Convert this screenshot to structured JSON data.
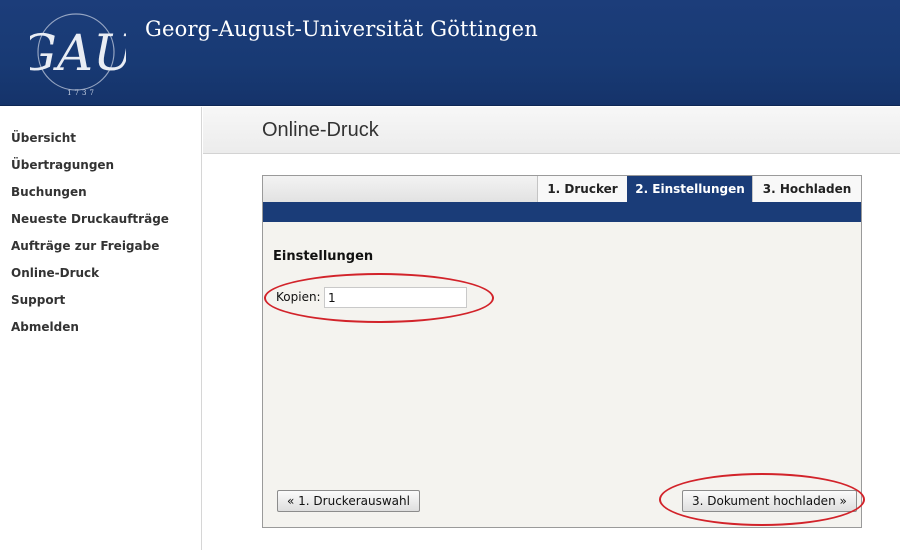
{
  "header": {
    "title": "Georg-August-Universität Göttingen",
    "logo": {
      "letters": "GAU",
      "year": "1737",
      "icon": "university-seal-icon"
    }
  },
  "sidebar": {
    "items": [
      {
        "label": "Übersicht"
      },
      {
        "label": "Übertragungen"
      },
      {
        "label": "Buchungen"
      },
      {
        "label": "Neueste Druckaufträge"
      },
      {
        "label": "Aufträge zur Freigabe"
      },
      {
        "label": "Online-Druck"
      },
      {
        "label": "Support"
      },
      {
        "label": "Abmelden"
      }
    ]
  },
  "main": {
    "page_title": "Online-Druck",
    "tabs": [
      {
        "label": "1. Drucker",
        "active": false
      },
      {
        "label": "2. Einstellungen",
        "active": true
      },
      {
        "label": "3. Hochladen",
        "active": false
      }
    ],
    "section_title": "Einstellungen",
    "copies_label": "Kopien:",
    "copies_value": "1",
    "back_button": "« 1. Druckerauswahl",
    "next_button": "3. Dokument hochladen »"
  },
  "colors": {
    "header_blue": "#1c3d7a",
    "active_tab": "#1a3c78",
    "annotation_red": "#d2232a",
    "panel_bg": "#f4f3ef"
  }
}
